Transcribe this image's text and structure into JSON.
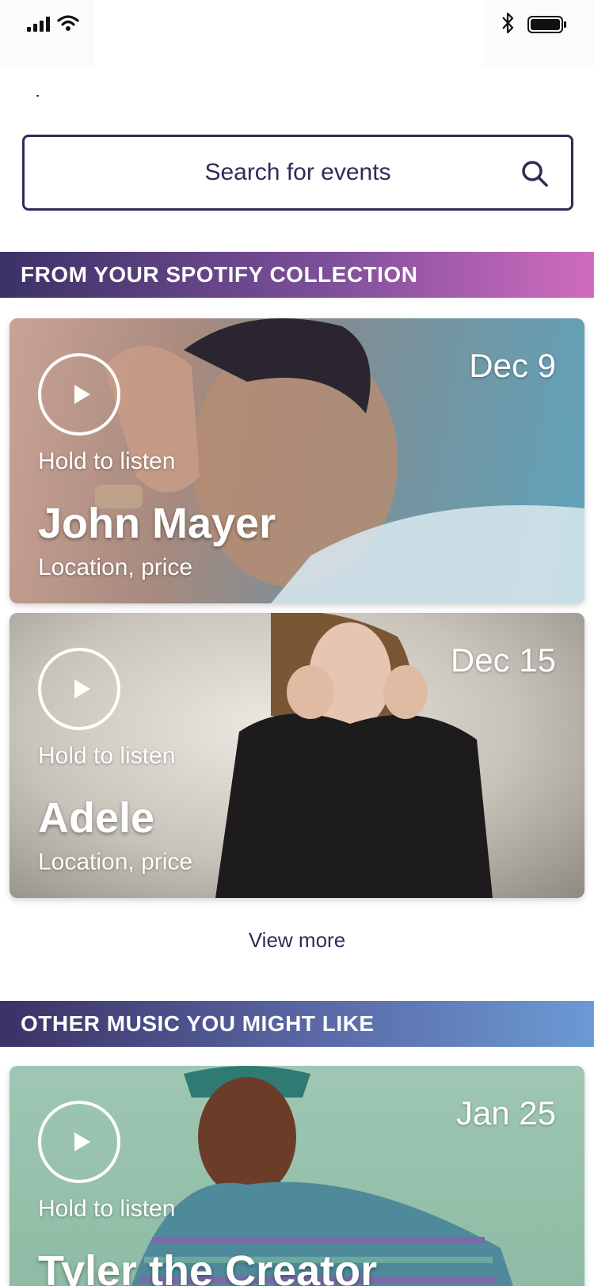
{
  "search": {
    "placeholder": "Search for events"
  },
  "sections": {
    "spotify": {
      "title": "FROM YOUR SPOTIFY COLLECTION"
    },
    "other": {
      "title": "OTHER MUSIC YOU MIGHT LIKE"
    }
  },
  "events": [
    {
      "date": "Dec 9",
      "hold": "Hold to listen",
      "artist": "John Mayer",
      "details": "Location, price"
    },
    {
      "date": "Dec 15",
      "hold": "Hold to listen",
      "artist": "Adele",
      "details": "Location, price"
    },
    {
      "date": "Jan 25",
      "hold": "Hold to listen",
      "artist": "Tyler the Creator"
    }
  ],
  "view_more": "View more",
  "colors": {
    "primary": "#332b56",
    "spotify_gradient_end": "#d06bbf",
    "other_gradient_end": "#6b9ad4"
  },
  "icons": {
    "signal": "cellular-signal-icon",
    "wifi": "wifi-icon",
    "bluetooth": "bluetooth-icon",
    "battery": "battery-icon",
    "search": "search-icon",
    "play": "play-icon"
  }
}
